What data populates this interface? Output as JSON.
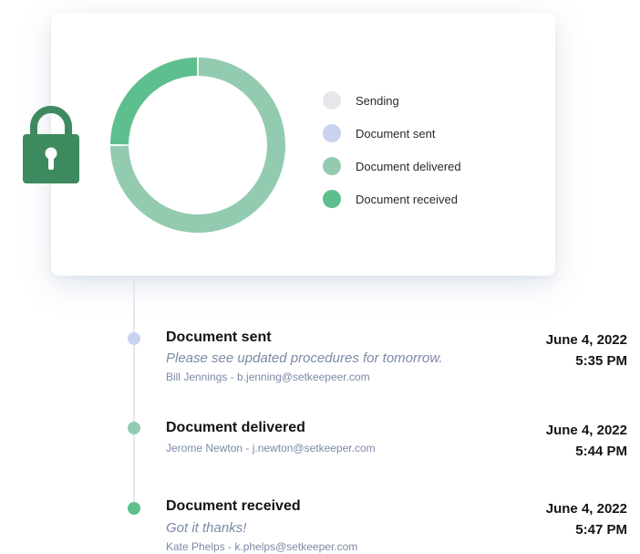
{
  "chart_data": {
    "type": "pie",
    "categories": [
      "Sending",
      "Document sent",
      "Document delivered",
      "Document received"
    ],
    "values": [
      0,
      0,
      75,
      25
    ],
    "colors": [
      "#e5e7ea",
      "#c9d3ef",
      "#93cbb0",
      "#5dbf8d"
    ],
    "legend": "right"
  },
  "legend": {
    "items": [
      {
        "label": "Sending",
        "color": "#e5e7ea"
      },
      {
        "label": "Document sent",
        "color": "#c9d3ef"
      },
      {
        "label": "Document delivered",
        "color": "#93cbb0"
      },
      {
        "label": "Document received",
        "color": "#5dbf8d"
      }
    ]
  },
  "lock_icon": {
    "icon": "lock-icon",
    "color": "#3d8a5f"
  },
  "timeline": {
    "events": [
      {
        "title": "Document sent",
        "note": "Please see updated procedures for tomorrow.",
        "meta": "Bill Jennings - b.jenning@setkeepeer.com",
        "date": "June 4, 2022",
        "time": "5:35 PM",
        "color": "#c9d3ef"
      },
      {
        "title": "Document delivered",
        "note": "",
        "meta": "Jerome Newton - j.newton@setkeeper.com",
        "date": "June 4, 2022",
        "time": "5:44 PM",
        "color": "#93cbb0"
      },
      {
        "title": "Document received",
        "note": "Got it thanks!",
        "meta": "Kate Phelps - k.phelps@setkeeper.com",
        "date": "June 4, 2022",
        "time": "5:47 PM",
        "color": "#5dbf8d"
      }
    ]
  }
}
